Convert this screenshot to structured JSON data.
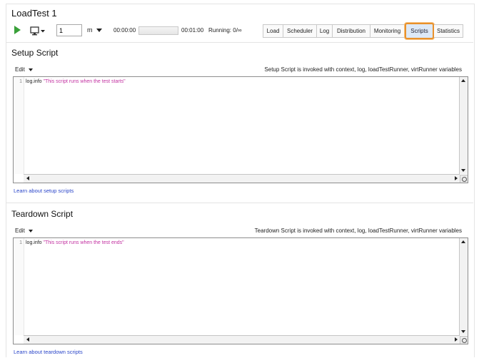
{
  "window": {
    "title": "LoadTest 1"
  },
  "toolbar": {
    "limit_value": "1",
    "limit_unit": "m",
    "elapsed": "00:00:00",
    "progress": 0,
    "total": "00:01:00",
    "running": "Running: 0/∞",
    "icons": {
      "run": "play-icon",
      "monitor": "monitor-icon"
    },
    "tabs": [
      {
        "label": "Load",
        "active": false
      },
      {
        "label": "Scheduler",
        "active": false
      },
      {
        "label": "Log",
        "active": false
      },
      {
        "label": "Distribution",
        "active": false
      },
      {
        "label": "Monitoring",
        "active": false
      },
      {
        "label": "Scripts",
        "active": true
      },
      {
        "label": "Statistics",
        "active": false
      }
    ]
  },
  "setup": {
    "title": "Setup Script",
    "edit_label": "Edit",
    "info": "Setup Script is invoked with context, log, loadTestRunner, virtRunner variables",
    "line_no": "1",
    "code_prefix": "log.info ",
    "code_string": "\"This script runs when the test starts\"",
    "learn": "Learn about setup scripts"
  },
  "teardown": {
    "title": "Teardown Script",
    "edit_label": "Edit",
    "info": "Teardown Script is invoked with context, log, loadTestRunner, virtRunner variables",
    "line_no": "1",
    "code_prefix": "log.info ",
    "code_string": "\"This script runs when the test ends\"",
    "learn": "Learn about teardown scripts"
  },
  "colors": {
    "accent": "#e8912c",
    "link": "#2a45c9",
    "run": "#3aa03a",
    "string": "#c22fa0"
  }
}
